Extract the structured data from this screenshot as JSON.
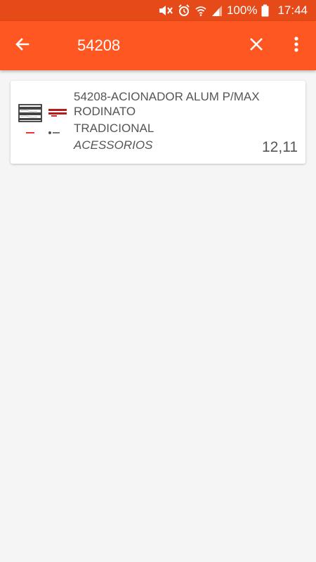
{
  "status_bar": {
    "battery": "100%",
    "time": "17:44"
  },
  "app_bar": {
    "search_query": "54208"
  },
  "results": [
    {
      "title": "54208-ACIONADOR ALUM P/MAX RODINATO",
      "line": "TRADICIONAL",
      "category": "ACESSORIOS",
      "price": "12,11"
    }
  ],
  "colors": {
    "status_bar": "#e64a19",
    "app_bar": "#ff5722",
    "background": "#f5f5f5",
    "text": "#555555"
  }
}
